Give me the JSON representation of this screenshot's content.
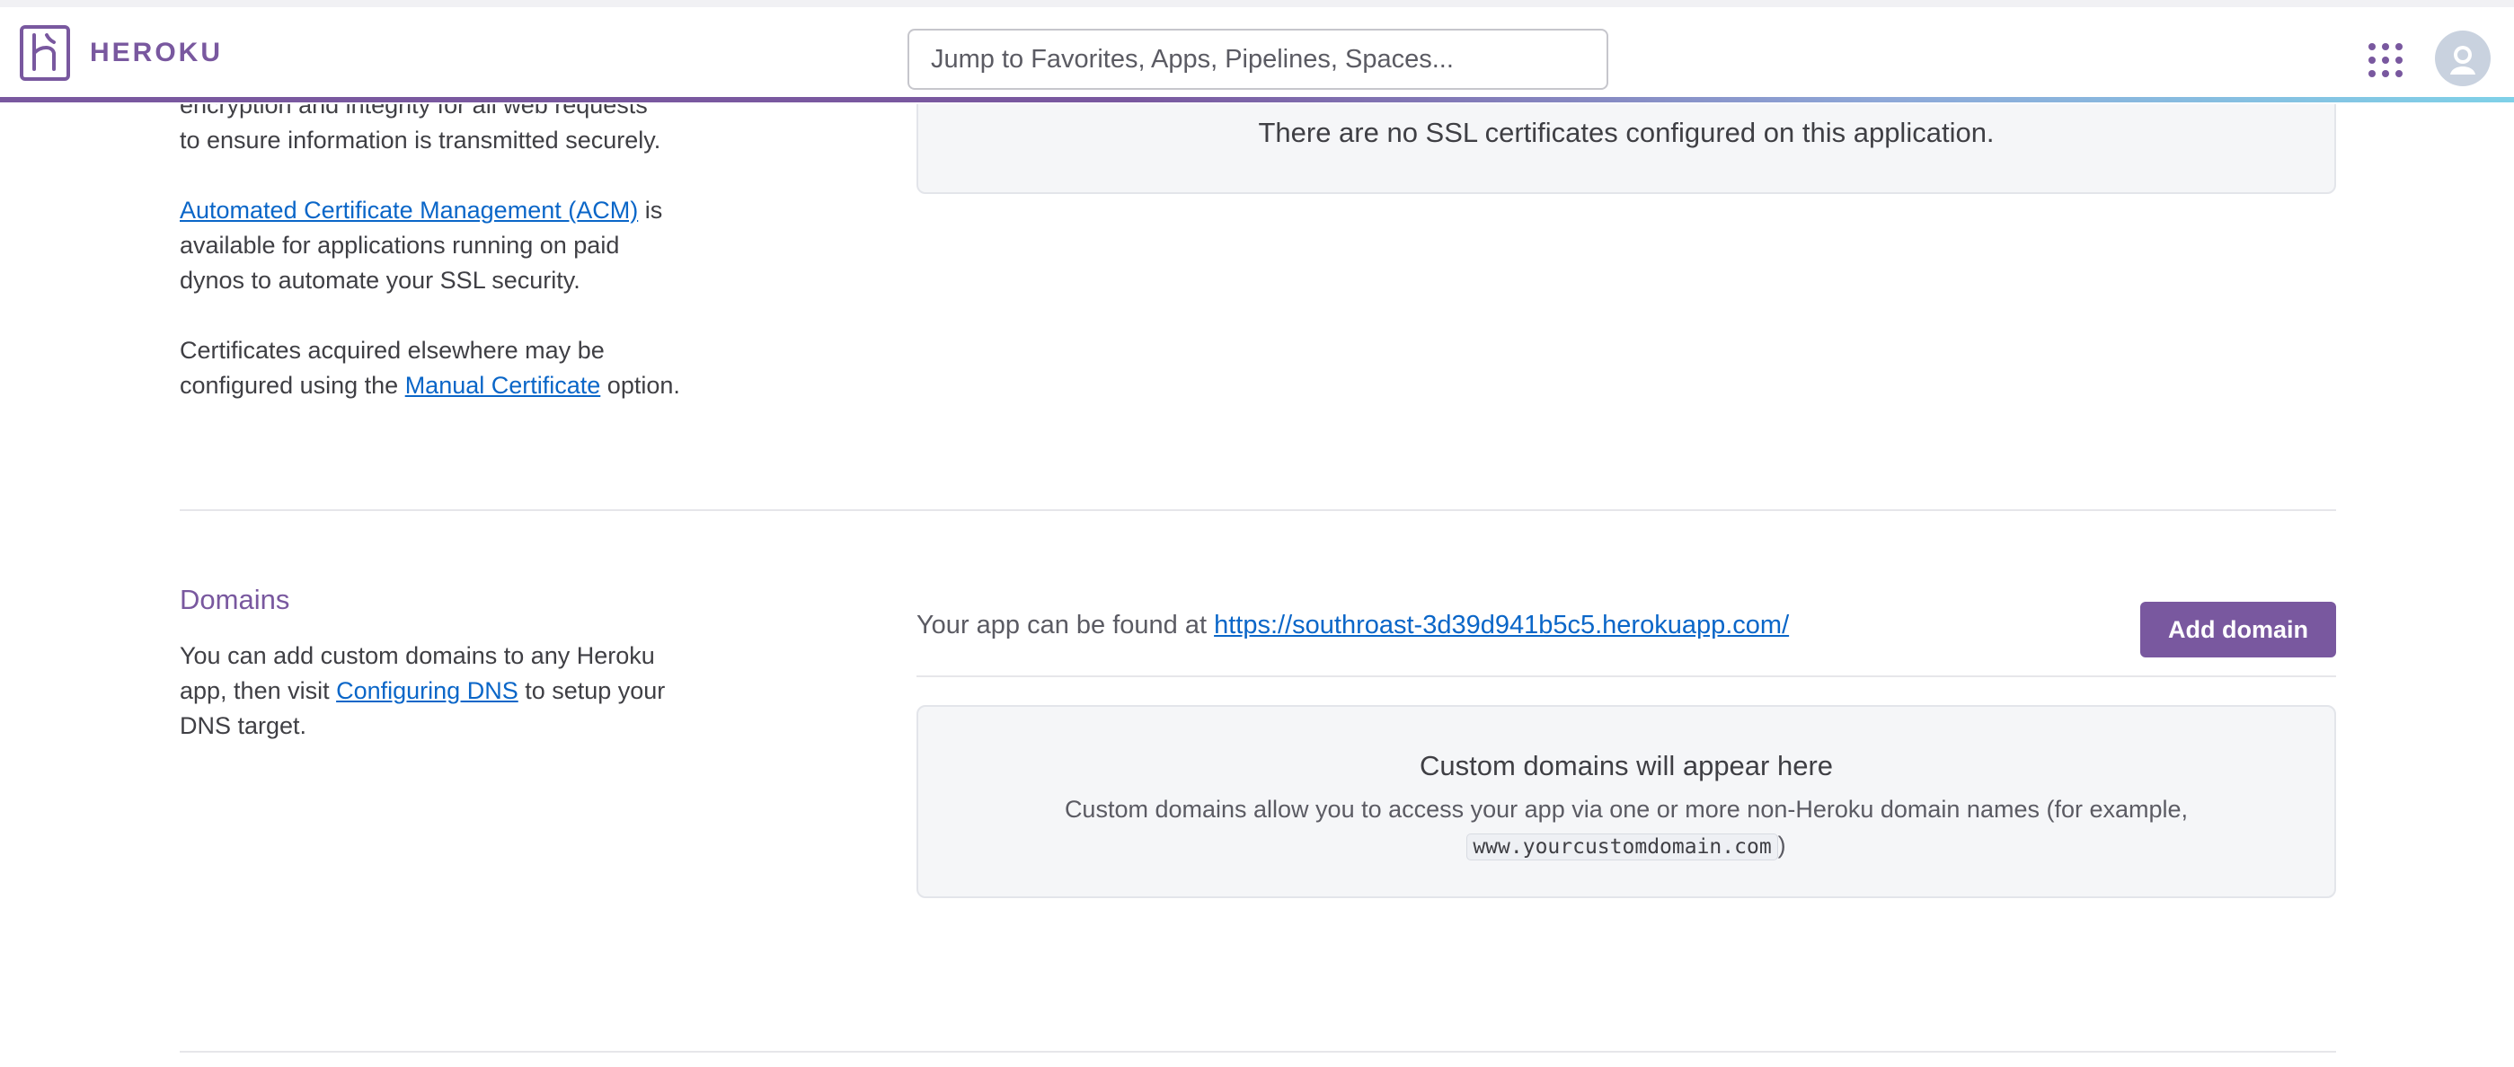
{
  "header": {
    "logo_text": "HEROKU",
    "search_placeholder": "Jump to Favorites, Apps, Pipelines, Spaces...",
    "apps_icon": "apps-grid-icon",
    "avatar_icon": "user-avatar-icon"
  },
  "ssl": {
    "desc_line1": "encryption and integrity for all web requests",
    "desc_line2": "to ensure information is transmitted securely.",
    "acm_link": "Automated Certificate Management (ACM)",
    "acm_rest": " is available for applications running on paid dynos to automate your SSL security.",
    "manual_pre": "Certificates acquired elsewhere may be configured using the ",
    "manual_link": "Manual Certificate",
    "manual_post": " option.",
    "empty_message": "There are no SSL certificates configured on this application."
  },
  "domains": {
    "title": "Domains",
    "desc_pre": "You can add custom domains to any Heroku app, then visit ",
    "desc_link": "Configuring DNS",
    "desc_post": " to setup your DNS target.",
    "found_at_label": "Your app can be found at ",
    "app_url": "https://southroast-3d39d941b5c5.herokuapp.com/",
    "add_button": "Add domain",
    "empty_title": "Custom domains will appear here",
    "empty_desc": "Custom domains allow you to access your app via one or more non-Heroku domain names (for example,",
    "example_domain": "www.yourcustomdomain.com",
    "example_close": ")"
  },
  "colors": {
    "brand": "#79589f",
    "link": "#0a66c8"
  }
}
